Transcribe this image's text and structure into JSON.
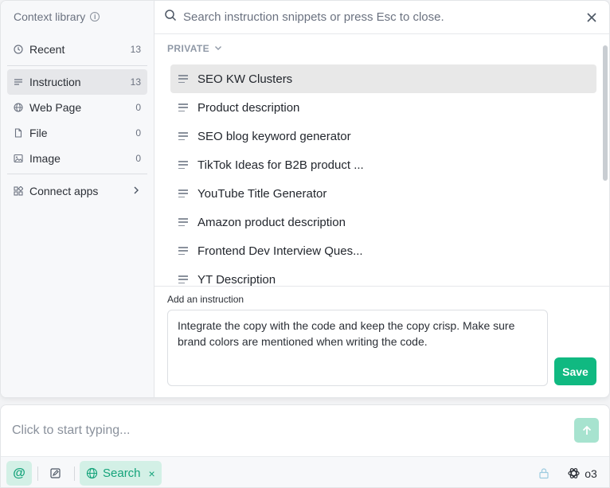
{
  "sidebar": {
    "title": "Context library",
    "items": [
      {
        "label": "Recent",
        "count": "13",
        "icon": "clock-icon"
      },
      {
        "label": "Instruction",
        "count": "13",
        "icon": "lines-icon"
      },
      {
        "label": "Web Page",
        "count": "0",
        "icon": "globe-icon"
      },
      {
        "label": "File",
        "count": "0",
        "icon": "file-icon"
      },
      {
        "label": "Image",
        "count": "0",
        "icon": "image-icon"
      }
    ],
    "connect_apps": "Connect apps"
  },
  "search": {
    "placeholder": "Search instruction snippets or press Esc to close."
  },
  "list": {
    "section": "PRIVATE",
    "snippets": [
      "SEO KW Clusters",
      "Product description",
      "SEO blog keyword generator",
      "TikTok Ideas for B2B product ...",
      "YouTube Title Generator",
      "Amazon product description",
      "Frontend Dev Interview Ques...",
      "YT Description"
    ]
  },
  "editor": {
    "label": "Add an instruction",
    "text": "Integrate the copy with the code and keep the copy crisp. Make sure brand colors are mentioned when writing the code.",
    "save_label": "Save"
  },
  "composer": {
    "placeholder": "Click to start typing...",
    "at_label": "@",
    "search_chip": "Search",
    "chip_close": "×",
    "model": "o3"
  },
  "colors": {
    "accent": "#10b981",
    "accent_soft": "#d3f0e6",
    "active_item": "#e6e7ea"
  }
}
